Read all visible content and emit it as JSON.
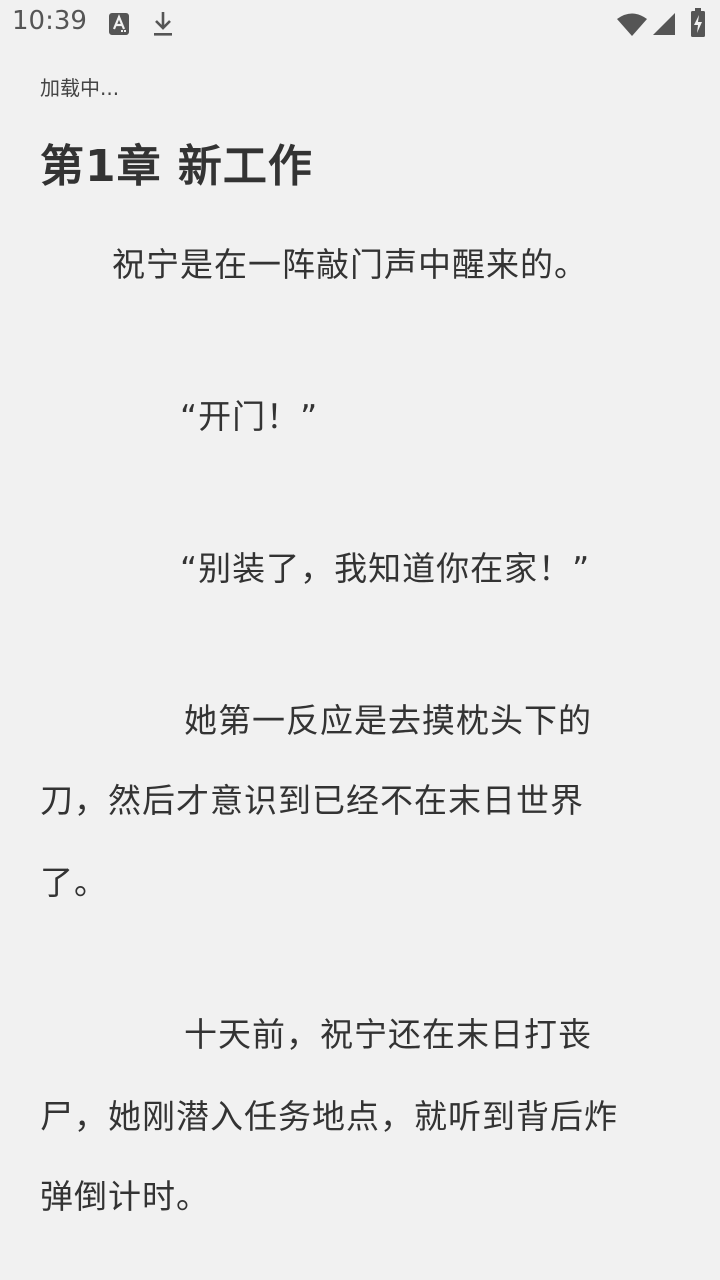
{
  "status_bar": {
    "time": "10:39",
    "left_icons": [
      "font-notification-icon",
      "download-icon"
    ],
    "right_icons": [
      "wifi-icon",
      "cell-signal-icon",
      "battery-charging-icon"
    ]
  },
  "reader": {
    "loading_label": "加载中...",
    "chapter_title": "第1章 新工作",
    "lines": [
      "祝宁是在一阵敲门声中醒来的。",
      "“开门！”",
      "“别装了，我知道你在家！”",
      "她第一反应是去摸枕头下的",
      "刀，然后才意识到已经不在末日世界",
      "了。",
      "十天前，祝宁还在末日打丧",
      "尸，她刚潜入任务地点，就听到背后炸",
      "弹倒计时。"
    ]
  },
  "colors": {
    "background": "#f1f1f1",
    "text": "#333333",
    "status_icons": "#555555"
  }
}
